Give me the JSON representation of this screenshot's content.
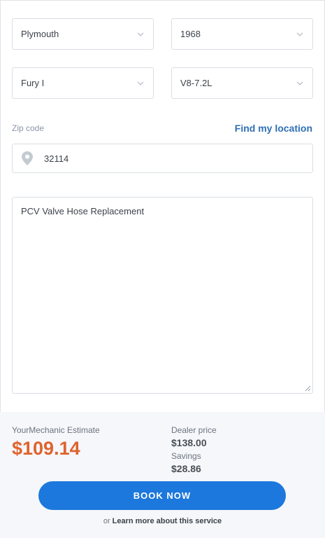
{
  "vehicle": {
    "make": "Plymouth",
    "year": "1968",
    "model": "Fury I",
    "engine": "V8-7.2L"
  },
  "location": {
    "zip_label": "Zip code",
    "find_location_label": "Find my location",
    "zip_value": "32114",
    "pin_icon": "map-pin-icon"
  },
  "service": {
    "description": "PCV Valve Hose Replacement"
  },
  "estimate": {
    "label": "YourMechanic Estimate",
    "value": "$109.14",
    "dealer_label": "Dealer price",
    "dealer_value": "$138.00",
    "savings_label": "Savings",
    "savings_value": "$28.86"
  },
  "actions": {
    "book_label": "BOOK NOW",
    "or_text": "or",
    "learn_more_label": "Learn more about this service"
  },
  "colors": {
    "accent": "#1c78dc",
    "price": "#e0632e",
    "link": "#2f6fb5"
  }
}
